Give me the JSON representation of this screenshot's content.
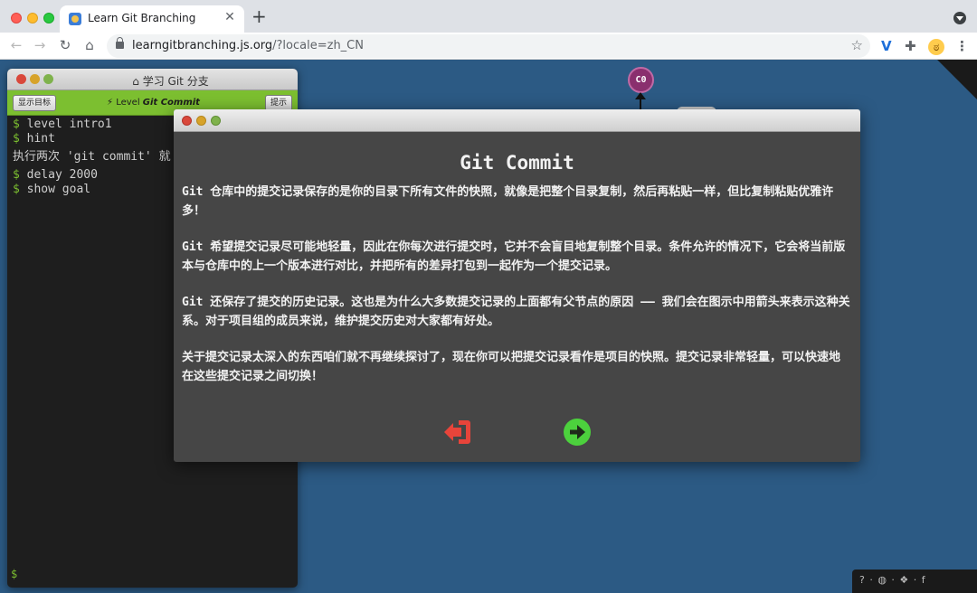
{
  "browser": {
    "tab_title": "Learn Git Branching",
    "tab_close": "✕",
    "new_tab": "+",
    "url_host": "learngitbranching.js.org",
    "url_path": "/?locale=zh_CN",
    "nav": {
      "back": "←",
      "forward": "→",
      "reload": "↻",
      "home": "⌂"
    },
    "star": "☆",
    "ext_v": "V",
    "ext_puzzle": "✚",
    "ext_emoji": "ಠ",
    "menu": "⋮"
  },
  "terminal": {
    "title": "学习 Git 分支",
    "show_goal_button": "显示目标",
    "hint_button": "提示",
    "level_prefix": "Level",
    "level_name": "Git Commit",
    "lines": [
      {
        "prompt": "$",
        "cmd": "level intro1"
      },
      {
        "prompt": "$",
        "cmd": "hint"
      }
    ],
    "output": "执行两次 'git commit' 就",
    "lines2": [
      {
        "prompt": "$",
        "cmd": "delay 2000"
      },
      {
        "prompt": "$",
        "cmd": "show goal"
      }
    ],
    "bottom_prompt": "$"
  },
  "graph": {
    "commit_label": "C0"
  },
  "modal": {
    "heading": "Git Commit",
    "paragraphs": [
      "Git 仓库中的提交记录保存的是你的目录下所有文件的快照，就像是把整个目录复制，然后再粘贴一样，但比复制粘贴优雅许多！",
      "Git 希望提交记录尽可能地轻量，因此在你每次进行提交时，它并不会盲目地复制整个目录。条件允许的情况下，它会将当前版本与仓库中的上一个版本进行对比，并把所有的差异打包到一起作为一个提交记录。",
      "Git 还保存了提交的历史记录。这也是为什么大多数提交记录的上面都有父节点的原因 —— 我们会在图示中用箭头来表示这种关系。对于项目组的成员来说，维护提交历史对大家都有好处。",
      "关于提交记录太深入的东西咱们就不再继续探讨了，现在你可以把提交记录看作是项目的快照。提交记录非常轻量，可以快速地在这些提交记录之间切换！"
    ],
    "exit_color": "#e8443a",
    "next_color": "#4cd13d"
  },
  "footer": {
    "icons": "? · ◍ · ❖ · f"
  }
}
